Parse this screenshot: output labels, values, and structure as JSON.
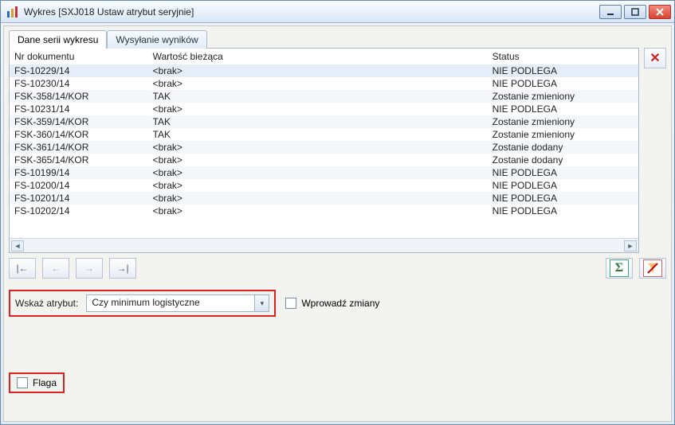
{
  "window": {
    "title": "Wykres [SXJ018 Ustaw atrybut seryjnie]"
  },
  "tabs": {
    "data": "Dane serii wykresu",
    "send": "Wysyłanie wyników"
  },
  "columns": {
    "doc": "Nr dokumentu",
    "val": "Wartość bieżąca",
    "status": "Status"
  },
  "rows": [
    {
      "doc": "FS-10229/14",
      "val": "<brak>",
      "status": "NIE PODLEGA"
    },
    {
      "doc": "FS-10230/14",
      "val": "<brak>",
      "status": "NIE PODLEGA"
    },
    {
      "doc": "FSK-358/14/KOR",
      "val": "TAK",
      "status": "Zostanie zmieniony"
    },
    {
      "doc": "FS-10231/14",
      "val": "<brak>",
      "status": "NIE PODLEGA"
    },
    {
      "doc": "FSK-359/14/KOR",
      "val": "TAK",
      "status": "Zostanie zmieniony"
    },
    {
      "doc": "FSK-360/14/KOR",
      "val": "TAK",
      "status": "Zostanie zmieniony"
    },
    {
      "doc": "FSK-361/14/KOR",
      "val": "<brak>",
      "status": "Zostanie dodany"
    },
    {
      "doc": "FSK-365/14/KOR",
      "val": "<brak>",
      "status": "Zostanie dodany"
    },
    {
      "doc": "FS-10199/14",
      "val": "<brak>",
      "status": "NIE PODLEGA"
    },
    {
      "doc": "FS-10200/14",
      "val": "<brak>",
      "status": "NIE PODLEGA"
    },
    {
      "doc": "FS-10201/14",
      "val": "<brak>",
      "status": "NIE PODLEGA"
    },
    {
      "doc": "FS-10202/14",
      "val": "<brak>",
      "status": "NIE PODLEGA"
    }
  ],
  "form": {
    "attr_label": "Wskaż atrybut:",
    "attr_value": "Czy minimum logistyczne",
    "apply_label": "Wprowadź zmiany",
    "flag_label": "Flaga"
  },
  "icons": {
    "nav_first": "|←",
    "nav_prev": "←",
    "nav_next": "→",
    "nav_last": "→|",
    "sigma": "Σ"
  }
}
